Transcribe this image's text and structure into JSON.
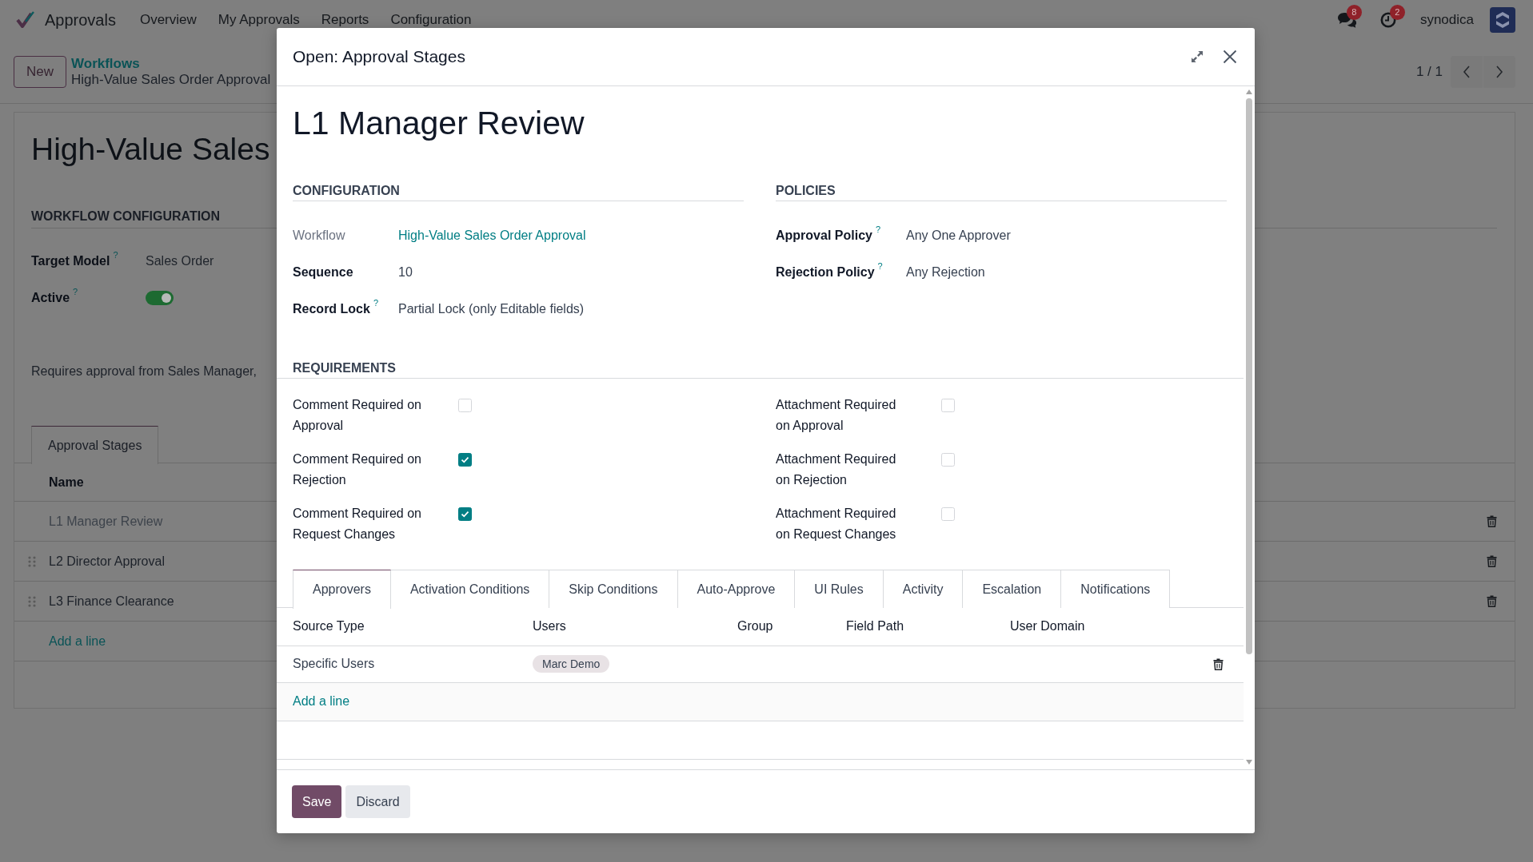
{
  "navbar": {
    "app_name": "Approvals",
    "menu": [
      {
        "label": "Overview"
      },
      {
        "label": "My Approvals"
      },
      {
        "label": "Reports"
      },
      {
        "label": "Configuration"
      }
    ],
    "indicators": [
      {
        "kind": "messages",
        "count": "8"
      },
      {
        "kind": "activities",
        "count": "2"
      }
    ],
    "user": "synodica"
  },
  "control_panel": {
    "new_button": "New",
    "breadcrumbs": [
      {
        "label": "Workflows",
        "kind": "link"
      },
      {
        "label": "High-Value Sales Order Approval",
        "kind": "current"
      }
    ],
    "pager": "1 / 1"
  },
  "form": {
    "title": "High-Value Sales",
    "section": "WORKFLOW CONFIGURATION",
    "fields": [
      {
        "label": "Target Model",
        "help": "?",
        "kind": "text",
        "value": "Sales Order"
      },
      {
        "label": "Active",
        "help": "?",
        "kind": "toggle",
        "on": true
      }
    ],
    "description": "Requires approval from Sales Manager,",
    "tabs": [
      {
        "label": "Approval Stages",
        "selected": true
      }
    ],
    "stages": {
      "columns": [
        "Name"
      ],
      "rows": [
        {
          "name": "L1 Manager Review",
          "selected": true
        },
        {
          "name": "L2 Director Approval",
          "selected": false
        },
        {
          "name": "L3 Finance Clearance",
          "selected": false
        }
      ],
      "add_line": "Add a line"
    }
  },
  "dialog": {
    "title": "Open: Approval Stages",
    "record_name": "L1 Manager Review",
    "sections": [
      {
        "title": "CONFIGURATION",
        "fields": [
          {
            "label": "Workflow",
            "readonly": true,
            "kind": "link",
            "value": "High-Value Sales Order Approval"
          },
          {
            "label": "Sequence",
            "readonly": false,
            "kind": "text",
            "value": "10"
          },
          {
            "label": "Record Lock",
            "help": "?",
            "readonly": false,
            "kind": "text",
            "value": "Partial Lock (only Editable fields)"
          }
        ]
      },
      {
        "title": "POLICIES",
        "fields": [
          {
            "label": "Approval Policy",
            "help": "?",
            "readonly": false,
            "kind": "text",
            "value": "Any One Approver"
          },
          {
            "label": "Rejection Policy",
            "help": "?",
            "readonly": false,
            "kind": "text",
            "value": "Any Rejection"
          }
        ]
      }
    ],
    "requirements": {
      "title": "REQUIREMENTS",
      "columns": [
        {
          "items": [
            {
              "label": "Comment Required on Approval",
              "checked": false
            },
            {
              "label": "Comment Required on Rejection",
              "checked": true
            },
            {
              "label": "Comment Required on Request Changes",
              "checked": true
            }
          ]
        },
        {
          "items": [
            {
              "label": "Attachment Required on Approval",
              "checked": false
            },
            {
              "label": "Attachment Required on Rejection",
              "checked": false
            },
            {
              "label": "Attachment Required on Request Changes",
              "checked": false
            }
          ]
        }
      ]
    },
    "tabs": [
      {
        "label": "Approvers",
        "selected": true
      },
      {
        "label": "Activation Conditions",
        "selected": false
      },
      {
        "label": "Skip Conditions",
        "selected": false
      },
      {
        "label": "Auto-Approve",
        "selected": false
      },
      {
        "label": "UI Rules",
        "selected": false
      },
      {
        "label": "Activity",
        "selected": false
      },
      {
        "label": "Escalation",
        "selected": false
      },
      {
        "label": "Notifications",
        "selected": false
      }
    ],
    "approvers": {
      "columns": [
        "Source Type",
        "Users",
        "Group",
        "Field Path",
        "User Domain"
      ],
      "rows": [
        {
          "source_type": "Specific Users",
          "users": [
            "Marc Demo"
          ]
        }
      ],
      "add_line": "Add a line"
    },
    "buttons": [
      {
        "label": "Save",
        "kind": "primary"
      },
      {
        "label": "Discard",
        "kind": "secondary"
      }
    ]
  }
}
